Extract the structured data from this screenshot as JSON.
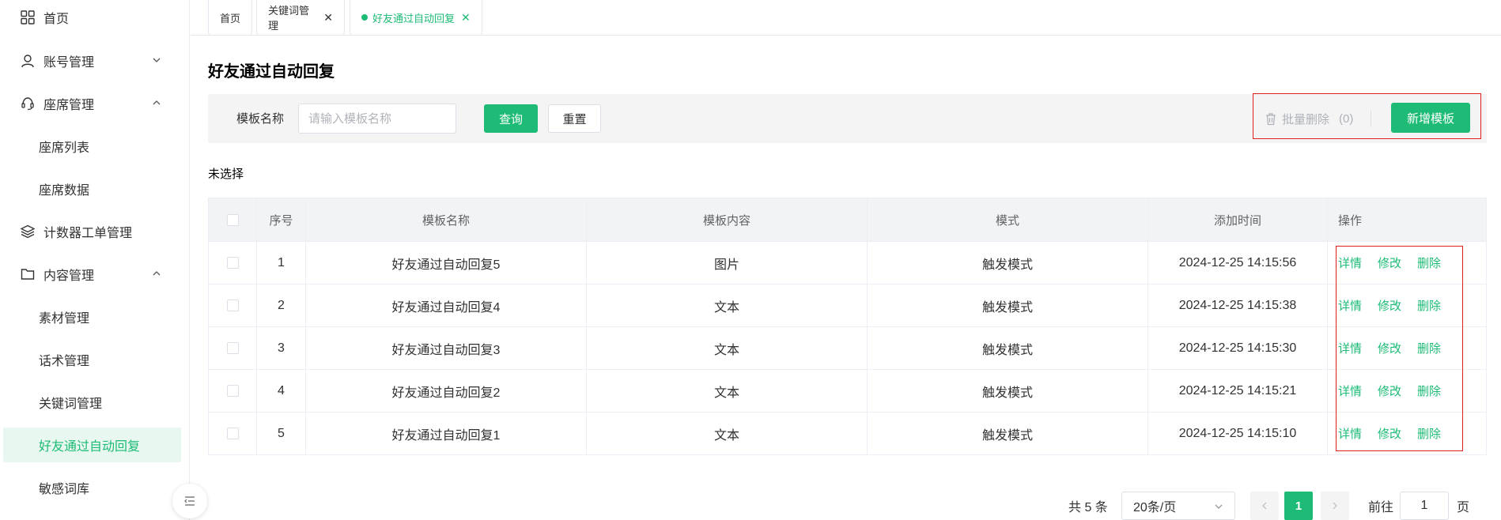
{
  "sidebar": {
    "items": [
      {
        "label": "首页",
        "icon": "grid-icon"
      },
      {
        "label": "账号管理",
        "icon": "user-icon",
        "expanded": false
      },
      {
        "label": "座席管理",
        "icon": "headset-icon",
        "expanded": true
      },
      {
        "label": "座席列表"
      },
      {
        "label": "座席数据"
      },
      {
        "label": "计数器工单管理",
        "icon": "layers-icon"
      },
      {
        "label": "内容管理",
        "icon": "folder-icon",
        "expanded": true
      },
      {
        "label": "素材管理"
      },
      {
        "label": "话术管理"
      },
      {
        "label": "关键词管理"
      },
      {
        "label": "好友通过自动回复",
        "active": true
      },
      {
        "label": "敏感词库"
      }
    ]
  },
  "tabs": [
    {
      "label": "首页"
    },
    {
      "label": "关键词管理"
    },
    {
      "label": "好友通过自动回复",
      "active": true
    }
  ],
  "page": {
    "title": "好友通过自动回复",
    "search_label": "模板名称",
    "search_placeholder": "请输入模板名称",
    "query_label": "查询",
    "reset_label": "重置",
    "batch_delete_label": "批量删除",
    "batch_delete_count": "(0)",
    "add_label": "新增模板",
    "selected_text": "未选择"
  },
  "table": {
    "headers": [
      "序号",
      "模板名称",
      "模板内容",
      "模式",
      "添加时间",
      "操作"
    ],
    "rows": [
      {
        "index": "1",
        "name": "好友通过自动回复5",
        "content": "图片",
        "mode": "触发模式",
        "time": "2024-12-25 14:15:56"
      },
      {
        "index": "2",
        "name": "好友通过自动回复4",
        "content": "文本",
        "mode": "触发模式",
        "time": "2024-12-25 14:15:38"
      },
      {
        "index": "3",
        "name": "好友通过自动回复3",
        "content": "文本",
        "mode": "触发模式",
        "time": "2024-12-25 14:15:30"
      },
      {
        "index": "4",
        "name": "好友通过自动回复2",
        "content": "文本",
        "mode": "触发模式",
        "time": "2024-12-25 14:15:21"
      },
      {
        "index": "5",
        "name": "好友通过自动回复1",
        "content": "文本",
        "mode": "触发模式",
        "time": "2024-12-25 14:15:10"
      }
    ],
    "actions": {
      "detail": "详情",
      "edit": "修改",
      "delete": "删除"
    }
  },
  "pagination": {
    "total_text": "共 5 条",
    "page_size": "20条/页",
    "current_page": "1",
    "goto_prefix": "前往",
    "goto_value": "1",
    "goto_suffix": "页"
  },
  "colors": {
    "accent": "#1dbb75",
    "highlight": "#e02020"
  }
}
